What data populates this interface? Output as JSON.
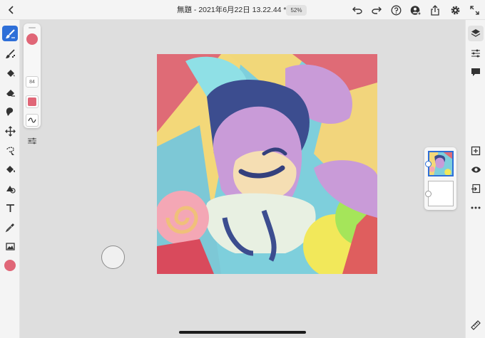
{
  "header": {
    "document_title": "無題 - 2021年6月22日 13.22.44 *",
    "zoom_level": "52%"
  },
  "brush_panel": {
    "brush_size": "84",
    "brush_color": "#e06677"
  },
  "left_toolbar": {
    "tools": [
      "paint-brush",
      "pixel-brush",
      "fill-brush",
      "eraser",
      "smudge",
      "transform",
      "selection",
      "fill",
      "shape",
      "text",
      "eyedropper",
      "image",
      "color"
    ],
    "active_tool": "paint-brush",
    "current_color": "#e06677"
  },
  "right_toolbar": {
    "tools": [
      "layers",
      "layer-properties",
      "comments",
      "add-layer",
      "layer-visibility",
      "layer-actions",
      "more-options",
      "ruler"
    ],
    "active_tool": "layers"
  },
  "layers_panel": {
    "layer_count": 2,
    "selected_layer": 1
  },
  "colors": {
    "accent": "#2e6fd8",
    "chrome": "#f4f4f4",
    "workspace": "#dedede"
  }
}
